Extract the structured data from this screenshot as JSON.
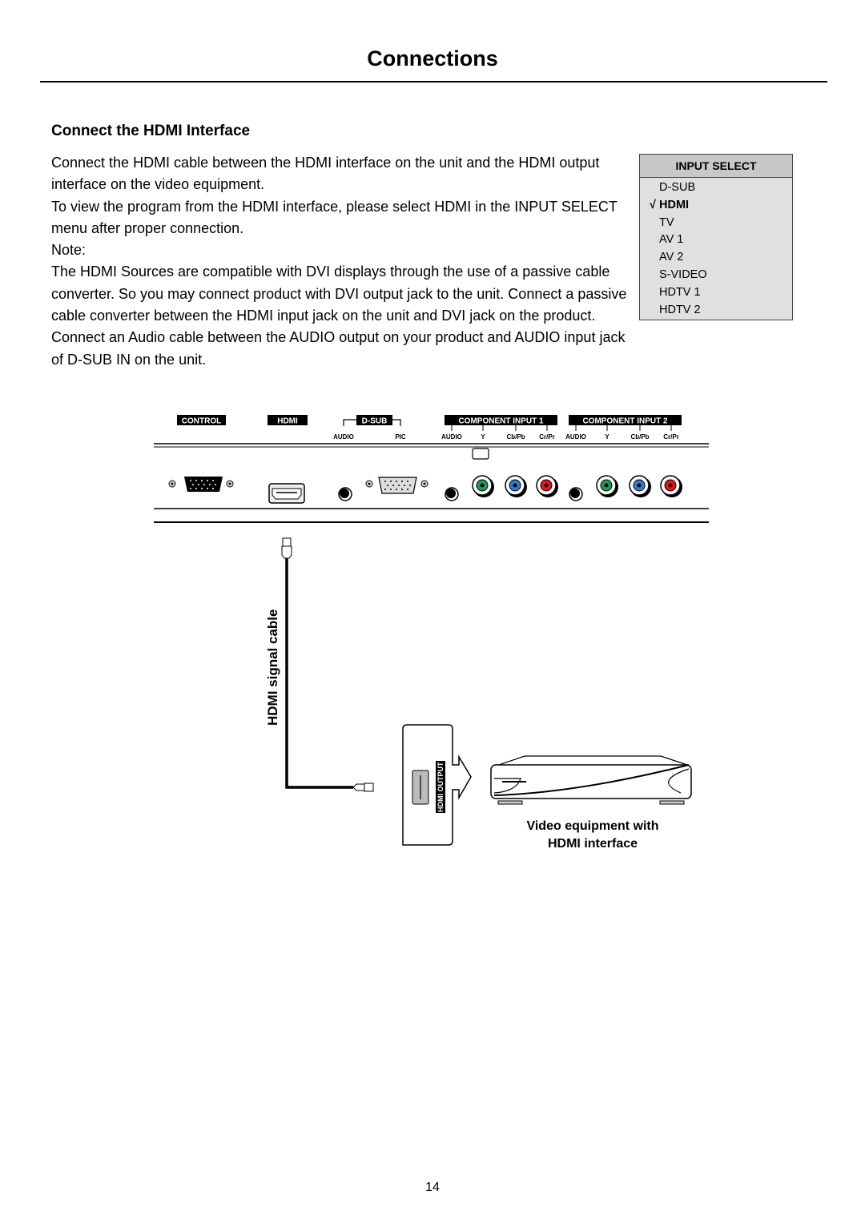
{
  "header": {
    "title": "Connections"
  },
  "section": {
    "title": "Connect the HDMI Interface",
    "paragraphs": [
      "Connect the HDMI cable between the HDMI interface on the unit and the HDMI output interface on the video equipment.",
      "To view the program from the HDMI interface, please select HDMI in the INPUT SELECT menu after proper connection.",
      "Note:",
      "The HDMI Sources are compatible with DVI displays through the use of a passive cable converter. So you may connect product with DVI output jack to the unit. Connect a passive cable converter between the HDMI input jack on the unit and DVI jack on the product. Connect an Audio cable between the AUDIO output on your product and AUDIO input jack of D-SUB IN on the unit."
    ]
  },
  "input_select_menu": {
    "title": "INPUT SELECT",
    "check_glyph": "√",
    "items": [
      {
        "label": "D-SUB",
        "selected": false
      },
      {
        "label": "HDMI",
        "selected": true
      },
      {
        "label": "TV",
        "selected": false
      },
      {
        "label": "AV 1",
        "selected": false
      },
      {
        "label": "AV 2",
        "selected": false
      },
      {
        "label": "S-VIDEO",
        "selected": false
      },
      {
        "label": "HDTV 1",
        "selected": false
      },
      {
        "label": "HDTV 2",
        "selected": false
      }
    ]
  },
  "panel": {
    "group_labels": {
      "control": "CONTROL",
      "hdmi": "HDMI",
      "dsub": "D-SUB",
      "component1": "COMPONENT INPUT 1",
      "component2": "COMPONENT INPUT 2"
    },
    "port_labels": {
      "dsub_audio": "AUDIO",
      "dsub_pic": "PIC",
      "c1_audio": "AUDIO",
      "c1_y": "Y",
      "c1_cb": "Cb/Pb",
      "c1_cr": "Cr/Pr",
      "c2_audio": "AUDIO",
      "c2_y": "Y",
      "c2_cb": "Cb/Pb",
      "c2_cr": "Cr/Pr"
    },
    "colors": {
      "y": "#1e9a5a",
      "pb": "#2e7fd0",
      "pr": "#e8121c"
    }
  },
  "diagram": {
    "cable_label": "HDMI signal cable",
    "output_port_label": "HDMI OUTPUT",
    "device_caption_line1": "Video equipment with",
    "device_caption_line2": "HDMI interface"
  },
  "footer": {
    "page_number": "14"
  }
}
